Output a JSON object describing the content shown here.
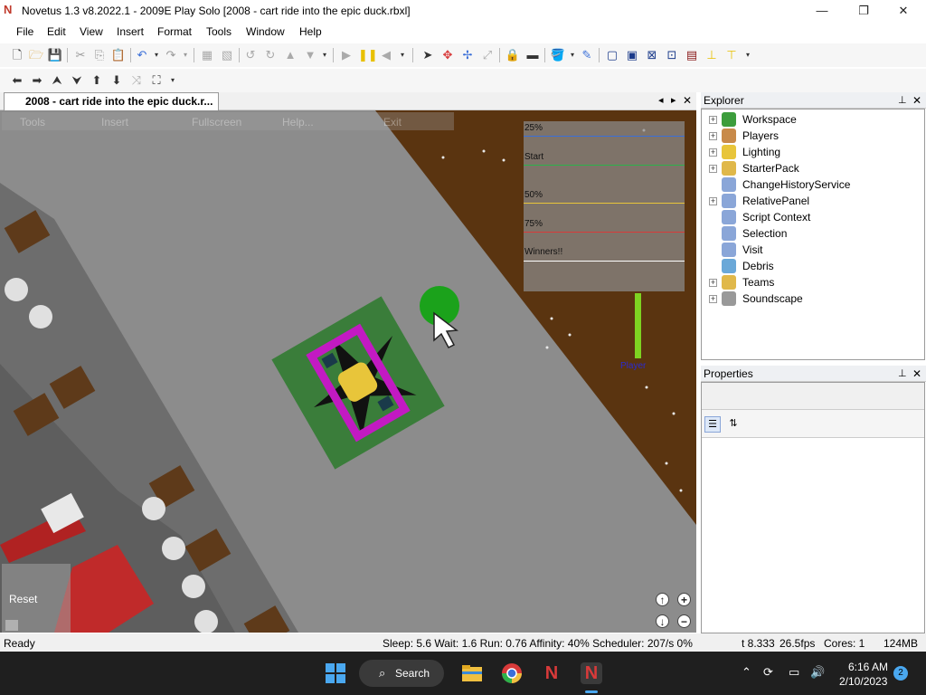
{
  "window": {
    "title": "Novetus 1.3 v8.2022.1 - 2009E Play Solo [2008 - cart ride into the epic duck.rbxl]",
    "logo": "N"
  },
  "window_controls": {
    "minimize": "—",
    "maximize": "❐",
    "close": "✕"
  },
  "menu": [
    "File",
    "Edit",
    "View",
    "Insert",
    "Format",
    "Tools",
    "Window",
    "Help"
  ],
  "document_tab": {
    "label": "2008 - cart ride into the epic duck.r...",
    "nav_left": "◂",
    "nav_right": "▸",
    "close": "✕"
  },
  "game_menu": [
    "Tools",
    "Insert",
    "Fullscreen",
    "Help...",
    "Exit"
  ],
  "progress_board": [
    {
      "label": "25%",
      "color": "#3a6fd8"
    },
    {
      "label": "Start",
      "color": "#2bb24a"
    },
    {
      "label": "50%",
      "color": "#e8c53a"
    },
    {
      "label": "75%",
      "color": "#d83a3a"
    },
    {
      "label": "Winners!!",
      "color": "#ffffff"
    }
  ],
  "player_label": "Player",
  "reset_button": "Reset",
  "explorer": {
    "title": "Explorer",
    "items": [
      {
        "label": "Workspace",
        "expandable": true,
        "icon": "globe-icon",
        "color": "#3c9d3c"
      },
      {
        "label": "Players",
        "expandable": true,
        "icon": "players-icon",
        "color": "#c88a4a"
      },
      {
        "label": "Lighting",
        "expandable": true,
        "icon": "lightbulb-icon",
        "color": "#e8c53a"
      },
      {
        "label": "StarterPack",
        "expandable": true,
        "icon": "folder-icon",
        "color": "#e0b84a"
      },
      {
        "label": "ChangeHistoryService",
        "expandable": false,
        "icon": "service-icon",
        "color": "#8aa6d8"
      },
      {
        "label": "RelativePanel",
        "expandable": true,
        "icon": "service-icon",
        "color": "#8aa6d8"
      },
      {
        "label": "Script Context",
        "expandable": false,
        "icon": "service-icon",
        "color": "#8aa6d8"
      },
      {
        "label": "Selection",
        "expandable": false,
        "icon": "service-icon",
        "color": "#8aa6d8"
      },
      {
        "label": "Visit",
        "expandable": false,
        "icon": "service-icon",
        "color": "#8aa6d8"
      },
      {
        "label": "Debris",
        "expandable": false,
        "icon": "debris-icon",
        "color": "#6aa8d8"
      },
      {
        "label": "Teams",
        "expandable": true,
        "icon": "folder-icon",
        "color": "#e0b84a"
      },
      {
        "label": "Soundscape",
        "expandable": true,
        "icon": "speaker-icon",
        "color": "#999999"
      }
    ]
  },
  "properties": {
    "title": "Properties"
  },
  "status": {
    "left": "Ready",
    "middle": "Sleep: 5.6 Wait: 1.6 Run: 0.76 Affinity: 40% Scheduler: 207/s 0%",
    "time": "t 8.333",
    "fps": "26.5fps",
    "cores": "Cores: 1",
    "mem": "124MB"
  },
  "taskbar": {
    "search": "Search",
    "time": "6:16 AM",
    "date": "2/10/2023",
    "notif_count": "2"
  }
}
